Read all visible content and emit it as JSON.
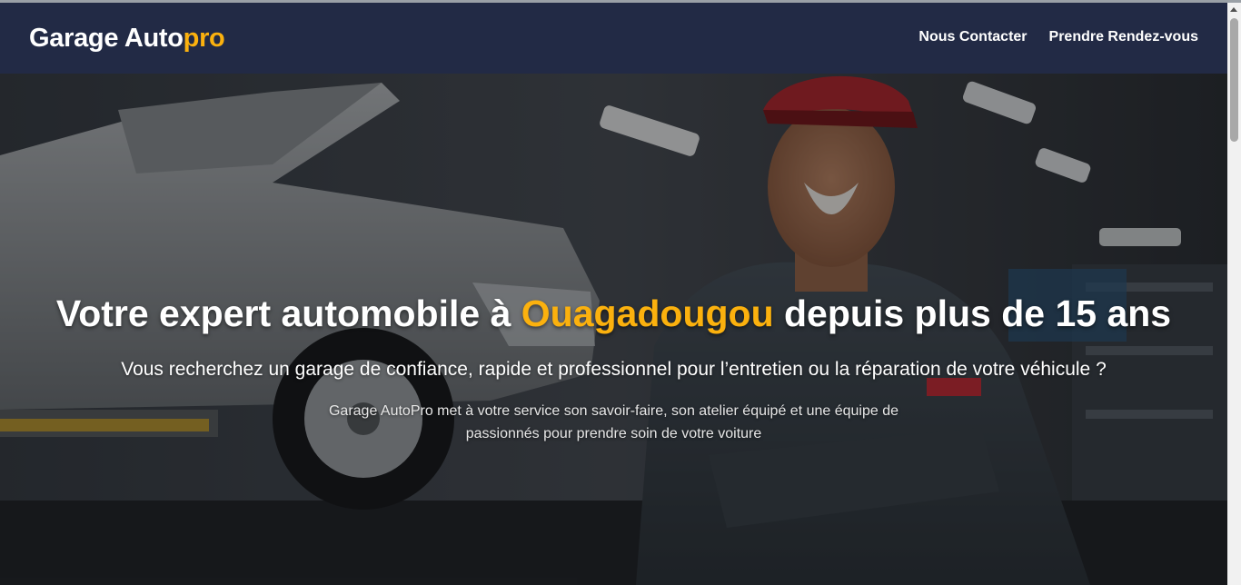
{
  "navbar": {
    "brand_main": "Garage Auto",
    "brand_accent": "pro",
    "links": [
      {
        "label": "Nous Contacter"
      },
      {
        "label": "Prendre Rendez-vous"
      }
    ]
  },
  "hero": {
    "title_before": "Votre expert automobile à ",
    "title_accent": "Ouagadougou",
    "title_after": " depuis plus de 15 ans",
    "subtitle": "Vous recherchez un garage de confiance, rapide et professionnel pour l’entretien ou la réparation de votre véhicule ?",
    "description": "Garage AutoPro met à votre service son savoir-faire, son atelier équipé et une équipe de passionnés pour prendre soin de votre voiture"
  },
  "colors": {
    "navbar_bg": "#222a45",
    "accent": "#fbb10e",
    "text": "#ffffff"
  }
}
